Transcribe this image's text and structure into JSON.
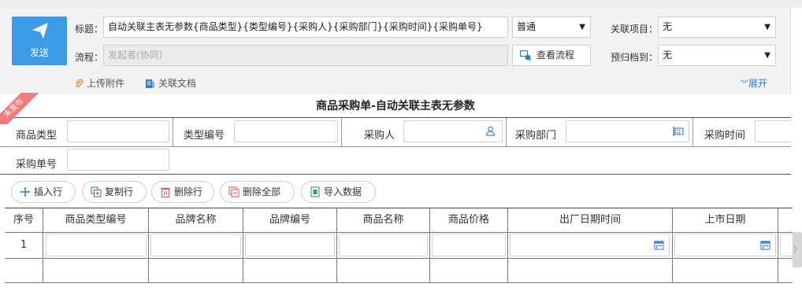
{
  "header": {
    "send_label": "发送",
    "title_label": "标题：",
    "title_value": "自动关联主表无参数{商品类型}{类型编号}{采购人}{采购部门}{采购时间}{采购单号}",
    "flow_label": "流程：",
    "flow_placeholder": "发起者(协同)",
    "priority_value": "普通",
    "view_flow_label": "查看流程",
    "related_project_label": "关联项目：",
    "related_project_value": "无",
    "archive_label": "预归档到：",
    "archive_value": "无",
    "upload_label": "上传附件",
    "related_doc_label": "关联文档",
    "expand_label": "展开"
  },
  "form": {
    "title": "商品采购单-自动关联主表无参数",
    "ribbon": "未发布",
    "fields": {
      "product_type": "商品类型",
      "type_code": "类型编号",
      "purchaser": "采购人",
      "purchase_dept": "采购部门",
      "purchase_time": "采购时间",
      "purchase_no": "采购单号"
    }
  },
  "toolbar": {
    "insert_row": "插入行",
    "copy_row": "复制行",
    "delete_row": "删除行",
    "delete_all": "删除全部",
    "import_data": "导入数据"
  },
  "table": {
    "columns": [
      "序号",
      "商品类型编号",
      "品牌名称",
      "品牌编号",
      "商品名称",
      "商品价格",
      "出厂日期时间",
      "上市日期"
    ],
    "rows": [
      {
        "index": "1"
      }
    ]
  },
  "colors": {
    "accent": "#3c9be4",
    "ribbon": "#f27b7b",
    "link": "#2b7bd0"
  }
}
